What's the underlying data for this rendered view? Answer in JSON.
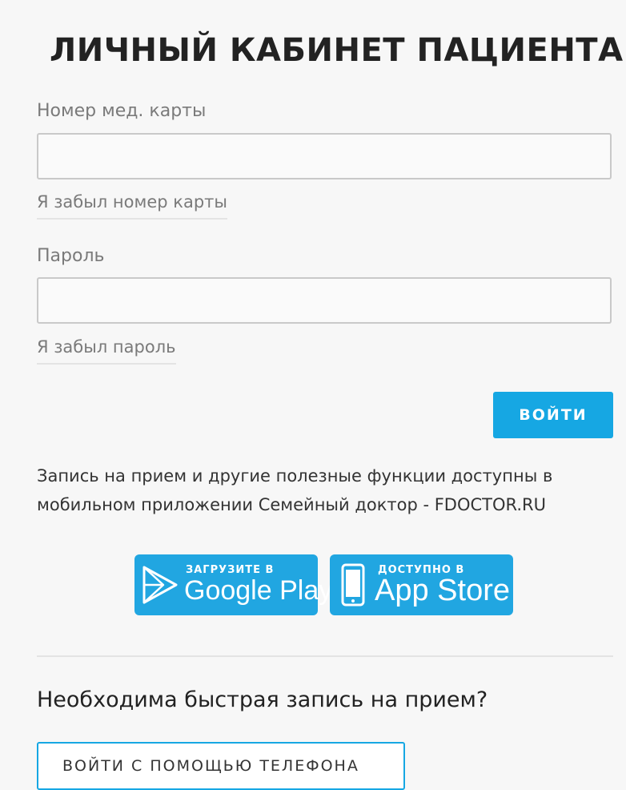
{
  "page": {
    "title": "ЛИЧНЫЙ КАБИНЕТ ПАЦИЕНТА"
  },
  "form": {
    "card_label": "Номер мед. карты",
    "card_value": "",
    "forgot_card": "Я забыл номер карты",
    "password_label": "Пароль",
    "password_value": "",
    "forgot_password": "Я забыл пароль",
    "login_button": "ВОЙТИ"
  },
  "info": {
    "text": "Запись на прием и другие полезные функции доступны в мобильном приложении Семейный доктор - FDOCTOR.RU"
  },
  "stores": {
    "google_play": {
      "small": "ЗАГРУЗИТЕ В",
      "big": "Google Play",
      "icon": "play-icon"
    },
    "app_store": {
      "small": "ДОСТУПНО В",
      "big": "App Store",
      "icon": "phone-icon"
    }
  },
  "quick": {
    "question": "Необходима быстрая запись на прием?",
    "phone_button": "ВОЙТИ С ПОМОЩЬЮ ТЕЛЕФОНА"
  },
  "colors": {
    "accent": "#16a7e3",
    "store_badge": "#21a6e1",
    "background": "#f7f7f7"
  }
}
